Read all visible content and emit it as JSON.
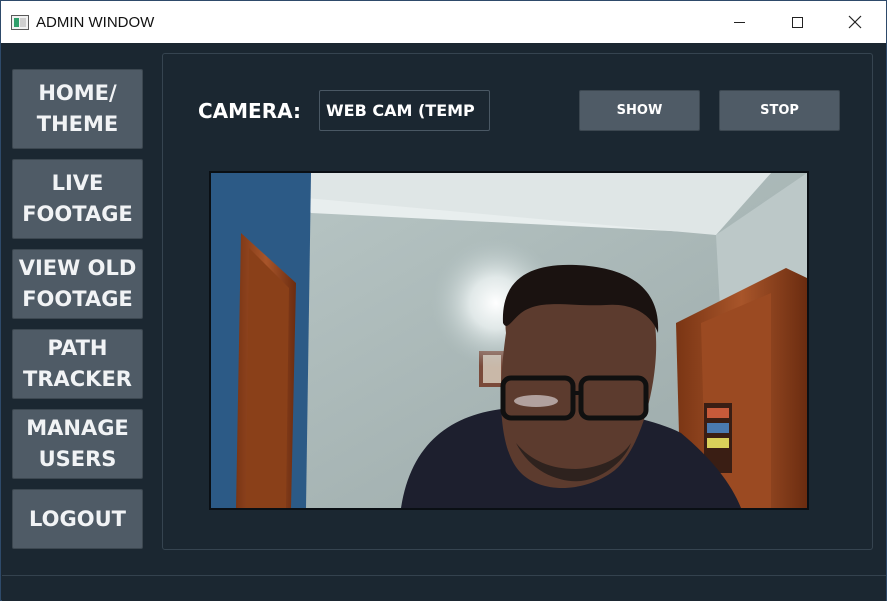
{
  "window": {
    "title": "ADMIN WINDOW"
  },
  "sidebar": {
    "items": [
      {
        "label": "HOME/\nTHEME"
      },
      {
        "label": "LIVE\nFOOTAGE"
      },
      {
        "label": "VIEW OLD\nFOOTAGE"
      },
      {
        "label": "PATH\nTRACKER"
      },
      {
        "label": "MANAGE\nUSERS"
      },
      {
        "label": "LOGOUT"
      }
    ]
  },
  "main": {
    "camera_label": "CAMERA:",
    "camera_value": "WEB CAM (TEMP",
    "show_label": "SHOW",
    "stop_label": "STOP"
  },
  "colors": {
    "window_bg": "#1b2731",
    "button_bg": "#4f5b66",
    "title_bar_bg": "#ffffff"
  },
  "icons": {
    "app": "app-window-icon",
    "minimize": "minimize-icon",
    "maximize": "maximize-icon",
    "close": "close-icon"
  }
}
